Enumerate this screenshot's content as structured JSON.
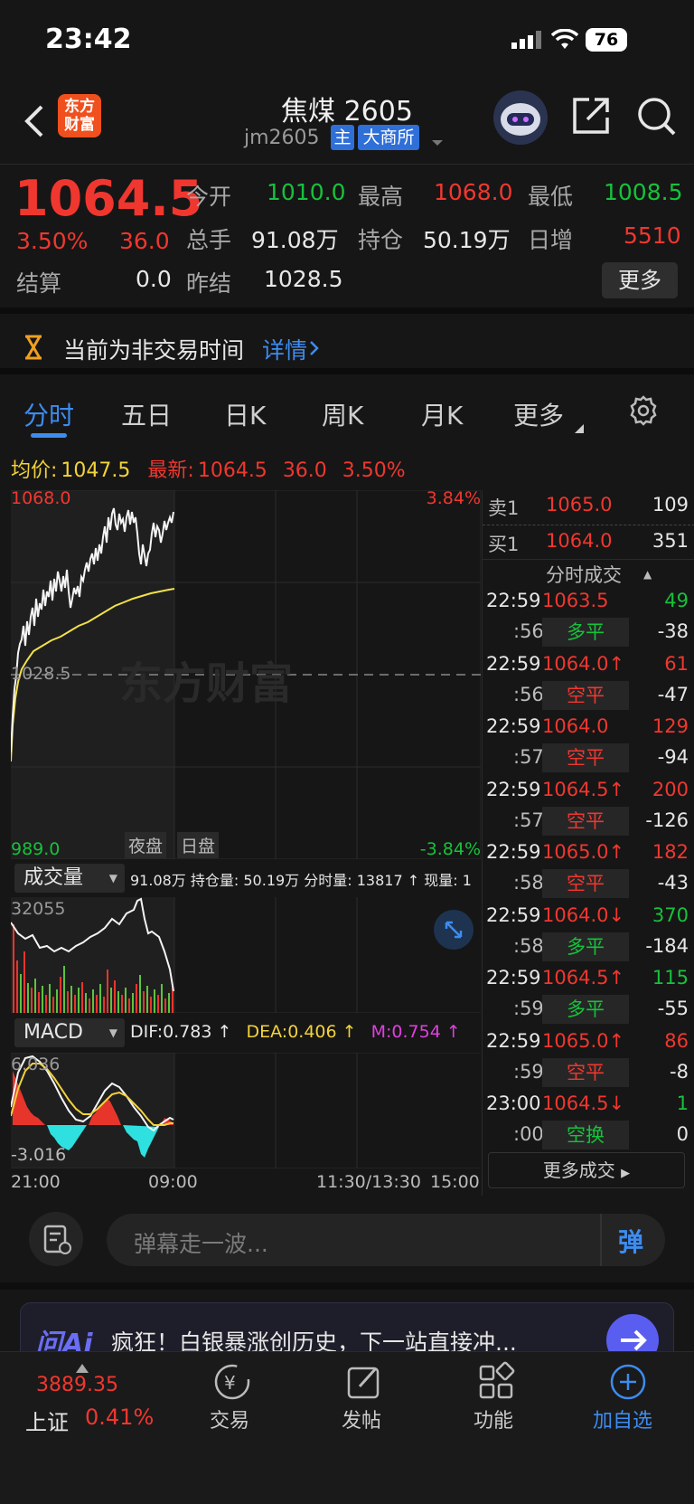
{
  "status": {
    "time": "23:42",
    "battery": "76"
  },
  "header": {
    "logo": "东方\n财富",
    "title": "焦煤 2605",
    "code": "jm2605",
    "tag_main": "主",
    "tag_exchange": "大商所"
  },
  "quote": {
    "price": "1064.5",
    "pct": "3.50%",
    "chg": "36.0",
    "open_label": "今开",
    "open": "1010.0",
    "high_label": "最高",
    "high": "1068.0",
    "low_label": "最低",
    "low": "1008.5",
    "vol_label": "总手",
    "vol": "91.08万",
    "oi_label": "持仓",
    "oi": "50.19万",
    "inc_label": "日增",
    "inc": "5510",
    "settle_label": "结算",
    "settle": "0.0",
    "presettle_label": "昨结",
    "presettle": "1028.5",
    "more": "更多"
  },
  "notice": {
    "text": "当前为非交易时间",
    "link": "详情"
  },
  "tabs": [
    "分时",
    "五日",
    "日K",
    "周K",
    "月K",
    "更多"
  ],
  "info": {
    "avg_label": "均价:",
    "avg": "1047.5",
    "last_label": "最新:",
    "last": "1064.5",
    "chg": "36.0",
    "pct": "3.50%"
  },
  "chart": {
    "ymax": "1068.0",
    "ymid": "1028.5",
    "ymin": "989.0",
    "pmax": "3.84%",
    "pmin": "-3.84%",
    "watermark": "东方财富",
    "night": "夜盘",
    "day": "日盘",
    "vol_select": "成交量",
    "vol_info": "91.08万 持仓量: 50.19万 分时量: 13817 ↑ 现量: 1",
    "vol_max": "32055",
    "macd_select": "MACD",
    "dif": "DIF:0.783 ↑",
    "dea": "DEA:0.406 ↑",
    "m": "M:0.754 ↑",
    "macd_max": "6.036",
    "macd_min": "-3.016",
    "x_labels": [
      "21:00",
      "09:00",
      "11:30/13:30",
      "15:00"
    ]
  },
  "book": {
    "ask_label": "卖1",
    "ask": "1065.0",
    "ask_vol": "109",
    "bid_label": "买1",
    "bid": "1064.0",
    "bid_vol": "351",
    "trades_title": "分时成交",
    "more_trades": "更多成交"
  },
  "trades": [
    {
      "t": "22:59",
      "p": "1063.5",
      "d": "",
      "v": "49",
      "pc": "red",
      "vc": "green",
      "s": ":56",
      "type": "多平",
      "tc": "green",
      "n": "-38"
    },
    {
      "t": "22:59",
      "p": "1064.0",
      "d": "↑",
      "v": "61",
      "pc": "red",
      "vc": "red",
      "s": ":56",
      "type": "空平",
      "tc": "red",
      "n": "-47"
    },
    {
      "t": "22:59",
      "p": "1064.0",
      "d": "",
      "v": "129",
      "pc": "red",
      "vc": "red",
      "s": ":57",
      "type": "空平",
      "tc": "red",
      "n": "-94"
    },
    {
      "t": "22:59",
      "p": "1064.5",
      "d": "↑",
      "v": "200",
      "pc": "red",
      "vc": "red",
      "s": ":57",
      "type": "空平",
      "tc": "red",
      "n": "-126"
    },
    {
      "t": "22:59",
      "p": "1065.0",
      "d": "↑",
      "v": "182",
      "pc": "red",
      "vc": "red",
      "s": ":58",
      "type": "空平",
      "tc": "red",
      "n": "-43"
    },
    {
      "t": "22:59",
      "p": "1064.0",
      "d": "↓",
      "v": "370",
      "pc": "red",
      "vc": "green",
      "s": ":58",
      "type": "多平",
      "tc": "green",
      "n": "-184"
    },
    {
      "t": "22:59",
      "p": "1064.5",
      "d": "↑",
      "v": "115",
      "pc": "red",
      "vc": "green",
      "s": ":59",
      "type": "多平",
      "tc": "green",
      "n": "-55"
    },
    {
      "t": "22:59",
      "p": "1065.0",
      "d": "↑",
      "v": "86",
      "pc": "red",
      "vc": "red",
      "s": ":59",
      "type": "空平",
      "tc": "red",
      "n": "-8"
    },
    {
      "t": "23:00",
      "p": "1064.5",
      "d": "↓",
      "v": "1",
      "pc": "red",
      "vc": "green",
      "s": ":00",
      "type": "空换",
      "tc": "green",
      "n": "0"
    }
  ],
  "comment": {
    "placeholder": "弹幕走一波...",
    "btn": "弹"
  },
  "ai": {
    "logo": "问Ai",
    "text": "疯狂！白银暴涨创历史，下一站直接冲..."
  },
  "nav": {
    "index_value": "3889.35",
    "index_name": "上证",
    "index_pct": "0.41%",
    "trade": "交易",
    "post": "发帖",
    "func": "功能",
    "add": "加自选"
  }
}
